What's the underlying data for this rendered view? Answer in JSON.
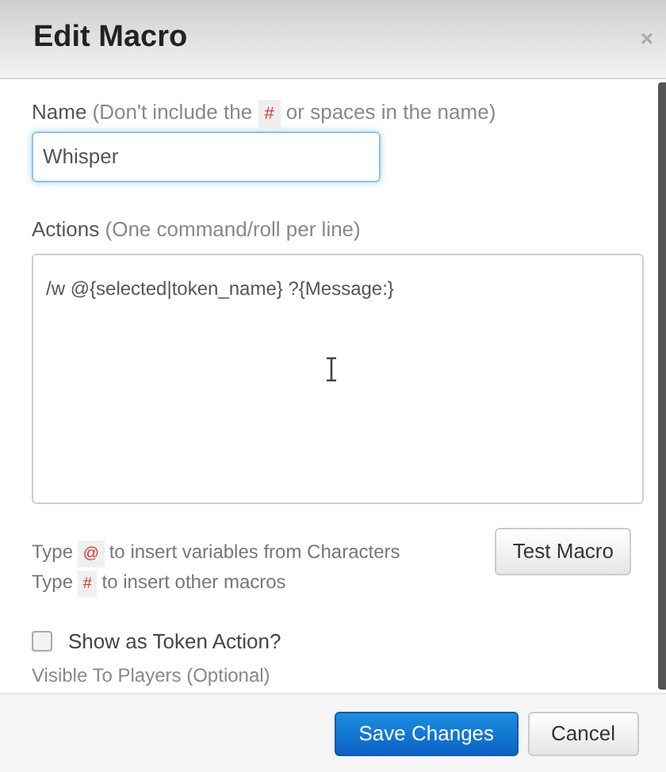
{
  "dialog": {
    "title": "Edit Macro",
    "close": "×"
  },
  "name_field": {
    "label": "Name",
    "hint_before": "(Don't include the",
    "hint_symbol": "#",
    "hint_after": "or spaces in the name)",
    "value": "Whisper"
  },
  "actions_field": {
    "label": "Actions",
    "hint": "(One command/roll per line)",
    "value": "/w @{selected|token_name} ?{Message:}"
  },
  "help_lines": [
    {
      "before": "Type",
      "symbol": "@",
      "after": "to insert variables from Characters"
    },
    {
      "before": "Type",
      "symbol": "#",
      "after": "to insert other macros"
    }
  ],
  "test_button": "Test Macro",
  "token_action": {
    "label": "Show as Token Action?",
    "checked": false
  },
  "visible_label": "Visible To Players (Optional)",
  "buttons": [
    {
      "label": "Save Changes",
      "kind": "primary"
    },
    {
      "label": "Cancel",
      "kind": "default"
    }
  ]
}
